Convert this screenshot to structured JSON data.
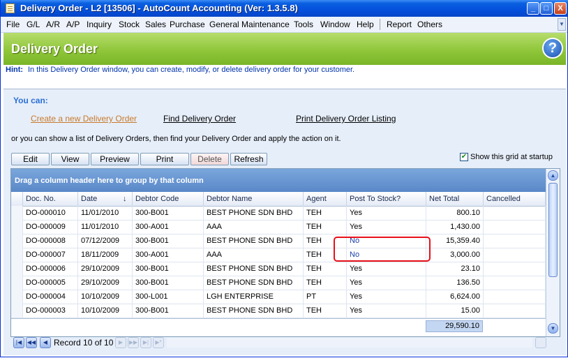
{
  "window": {
    "title": "Delivery Order - L2 [13506] - AutoCount Accounting (Ver: 1.3.5.8)",
    "controls": [
      "_",
      "□",
      "X"
    ]
  },
  "menu": [
    "File",
    "G/L",
    "A/R",
    "A/P",
    "Inquiry",
    "Stock",
    "Sales",
    "Purchase",
    "General Maintenance",
    "Tools",
    "Window",
    "Help",
    "Report",
    "Others"
  ],
  "banner": {
    "title": "Delivery Order",
    "help": "?"
  },
  "hint": {
    "label": "Hint:",
    "text": "In this Delivery Order window, you can create, modify, or delete delivery order for your customer."
  },
  "actions": {
    "heading": "You can:",
    "create": "Create a new Delivery Order",
    "find": "Find Delivery Order",
    "print_listing": "Print Delivery Order Listing",
    "or_text": "or you can show a list of Delivery Orders, then find your Delivery Order and apply the action on it."
  },
  "toolbar": {
    "edit": "Edit",
    "view": "View",
    "preview": "Preview",
    "print": "Print",
    "delete": "Delete",
    "refresh": "Refresh",
    "show_grid_label": "Show this grid at startup",
    "show_grid_checked": true
  },
  "grid": {
    "group_hint": "Drag a column header here to group by that column",
    "sort_indicator": "↓",
    "columns": [
      "Doc. No.",
      "Date",
      "Debtor Code",
      "Debtor Name",
      "Agent",
      "Post To Stock?",
      "Net Total",
      "Cancelled"
    ],
    "rows": [
      [
        "DO-000010",
        "11/01/2010",
        "300-B001",
        "BEST PHONE SDN BHD",
        "TEH",
        "Yes",
        "800.10",
        ""
      ],
      [
        "DO-000009",
        "11/01/2010",
        "300-A001",
        "AAA",
        "TEH",
        "Yes",
        "1,430.00",
        ""
      ],
      [
        "DO-000008",
        "07/12/2009",
        "300-B001",
        "BEST PHONE SDN BHD",
        "TEH",
        "No",
        "15,359.40",
        ""
      ],
      [
        "DO-000007",
        "18/11/2009",
        "300-A001",
        "AAA",
        "TEH",
        "No",
        "3,000.00",
        ""
      ],
      [
        "DO-000006",
        "29/10/2009",
        "300-B001",
        "BEST PHONE SDN BHD",
        "TEH",
        "Yes",
        "23.10",
        ""
      ],
      [
        "DO-000005",
        "29/10/2009",
        "300-B001",
        "BEST PHONE SDN BHD",
        "TEH",
        "Yes",
        "136.50",
        ""
      ],
      [
        "DO-000004",
        "10/10/2009",
        "300-L001",
        "LGH ENTERPRISE",
        "PT",
        "Yes",
        "6,624.00",
        ""
      ],
      [
        "DO-000003",
        "10/10/2009",
        "300-B001",
        "BEST PHONE SDN BHD",
        "TEH",
        "Yes",
        "15.00",
        ""
      ]
    ],
    "total": "29,590.10",
    "record_text": "Record 10 of 10"
  },
  "colors": {
    "title_blue": "#0550dc",
    "banner_green": "#8fc63a",
    "highlight_red": "#e8101a",
    "link_orange": "#c87a2a",
    "no_value_blue": "#1a3fa8"
  }
}
